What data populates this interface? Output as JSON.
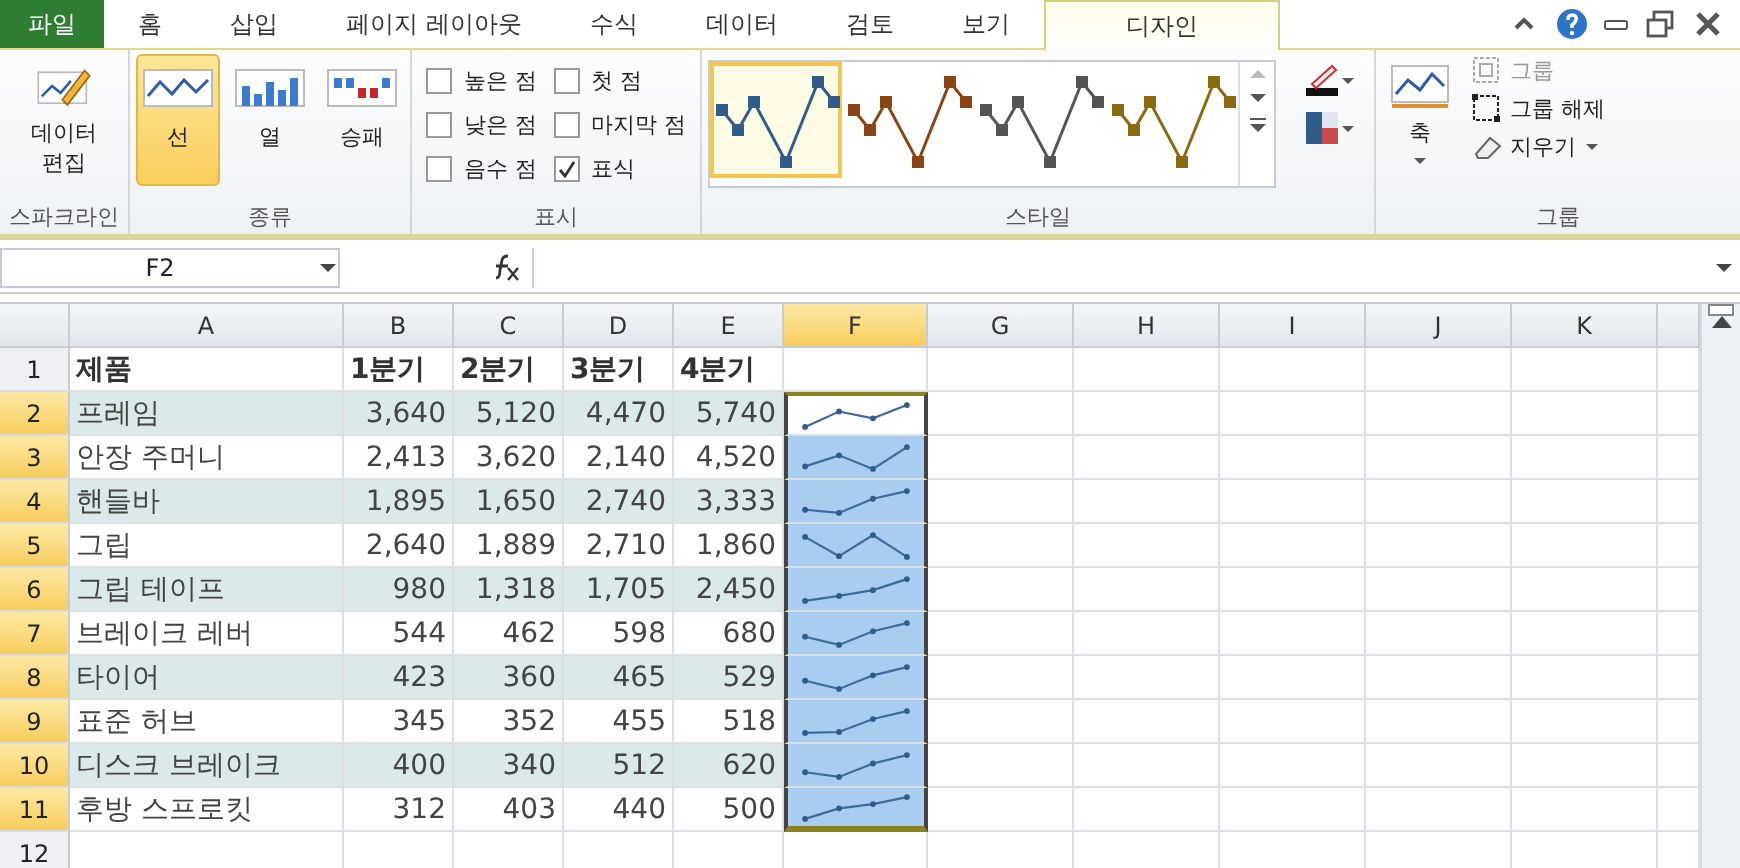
{
  "tabs": [
    {
      "label": "파일",
      "kind": "file",
      "selected": false
    },
    {
      "label": "홈",
      "selected": false
    },
    {
      "label": "삽입",
      "selected": false
    },
    {
      "label": "페이지 레이아웃",
      "selected": false
    },
    {
      "label": "수식",
      "selected": false
    },
    {
      "label": "데이터",
      "selected": false
    },
    {
      "label": "검토",
      "selected": false
    },
    {
      "label": "보기",
      "selected": false
    },
    {
      "label": "디자인",
      "selected": true
    }
  ],
  "ribbon": {
    "sparkline_group": {
      "label": "스파크라인",
      "edit_button": "데이터\n편집"
    },
    "type_group": {
      "label": "종류",
      "types": [
        {
          "label": "선",
          "kind": "line",
          "selected": true
        },
        {
          "label": "열",
          "kind": "column",
          "selected": false
        },
        {
          "label": "승패",
          "kind": "winloss",
          "selected": false
        }
      ]
    },
    "show_group": {
      "label": "표시",
      "options": [
        {
          "label": "높은 점",
          "checked": false
        },
        {
          "label": "낮은 점",
          "checked": false
        },
        {
          "label": "음수 점",
          "checked": false
        },
        {
          "label": "첫 점",
          "checked": false
        },
        {
          "label": "마지막 점",
          "checked": false
        },
        {
          "label": "표식",
          "checked": true
        }
      ]
    },
    "style_group": {
      "label": "스타일",
      "styles": [
        {
          "color": "#2f5c8a",
          "selected": true
        },
        {
          "color": "#8b4513",
          "selected": false
        },
        {
          "color": "#555555",
          "selected": false
        },
        {
          "color": "#8b6a10",
          "selected": false
        }
      ]
    },
    "group_group": {
      "label": "그룹",
      "axis": "축",
      "group": {
        "label": "그룹",
        "disabled": true
      },
      "ungroup": {
        "label": "그룹 해제",
        "disabled": false
      },
      "clear": "지우기"
    }
  },
  "name_box": "F2",
  "columns": [
    {
      "label": "A",
      "selected": false
    },
    {
      "label": "B",
      "selected": false
    },
    {
      "label": "C",
      "selected": false
    },
    {
      "label": "D",
      "selected": false
    },
    {
      "label": "E",
      "selected": false
    },
    {
      "label": "F",
      "selected": true
    },
    {
      "label": "G",
      "selected": false
    },
    {
      "label": "H",
      "selected": false
    },
    {
      "label": "I",
      "selected": false
    },
    {
      "label": "J",
      "selected": false
    },
    {
      "label": "K",
      "selected": false
    }
  ],
  "header_row": {
    "number": "1",
    "cells": [
      "제품",
      "1분기",
      "2분기",
      "3분기",
      "4분기"
    ]
  },
  "rows": [
    {
      "number": "2",
      "product": "프레임",
      "values": [
        "3,640",
        "5,120",
        "4,470",
        "5,740"
      ],
      "selected": true
    },
    {
      "number": "3",
      "product": "안장 주머니",
      "values": [
        "2,413",
        "3,620",
        "2,140",
        "4,520"
      ],
      "selected": true
    },
    {
      "number": "4",
      "product": "핸들바",
      "values": [
        "1,895",
        "1,650",
        "2,740",
        "3,333"
      ],
      "selected": true
    },
    {
      "number": "5",
      "product": "그립",
      "values": [
        "2,640",
        "1,889",
        "2,710",
        "1,860"
      ],
      "selected": true
    },
    {
      "number": "6",
      "product": "그립 테이프",
      "values": [
        "980",
        "1,318",
        "1,705",
        "2,450"
      ],
      "selected": true
    },
    {
      "number": "7",
      "product": "브레이크 레버",
      "values": [
        "544",
        "462",
        "598",
        "680"
      ],
      "selected": true
    },
    {
      "number": "8",
      "product": "타이어",
      "values": [
        "423",
        "360",
        "465",
        "529"
      ],
      "selected": true
    },
    {
      "number": "9",
      "product": "표준 허브",
      "values": [
        "345",
        "352",
        "455",
        "518"
      ],
      "selected": true
    },
    {
      "number": "10",
      "product": "디스크 브레이크",
      "values": [
        "400",
        "340",
        "512",
        "620"
      ],
      "selected": true
    },
    {
      "number": "11",
      "product": "후방 스프로킷",
      "values": [
        "312",
        "403",
        "440",
        "500"
      ],
      "selected": true
    }
  ],
  "next_row": "12"
}
